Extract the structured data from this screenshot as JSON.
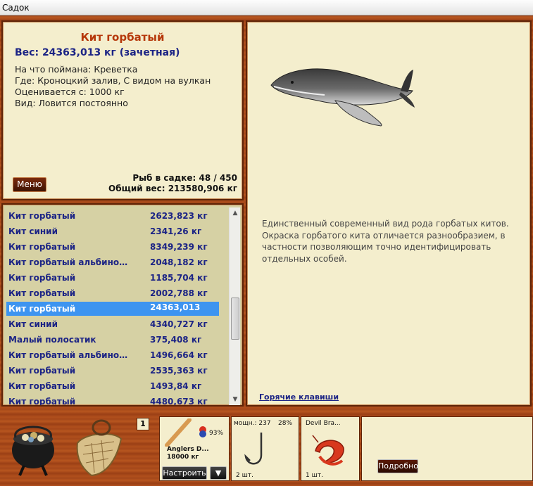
{
  "window": {
    "title": "Садок"
  },
  "fish": {
    "name": "Кит горбатый",
    "weight_line": "Вес: 24363,013 кг (зачетная)",
    "bait": "На что поймана: Креветка",
    "location": "Где: Кроноцкий залив, С видом на вулкан",
    "value": "Оценивается с: 1000 кг",
    "type": "Вид: Ловится постоянно"
  },
  "keepnet": {
    "menu_label": "Меню",
    "fish_count": "Рыб в садке: 48 / 450",
    "total_weight": "Общий вес: 213580,906 кг"
  },
  "fish_list": [
    {
      "name": "Кит горбатый",
      "weight": "2623,823 кг"
    },
    {
      "name": "Кит синий",
      "weight": "2341,26 кг"
    },
    {
      "name": "Кит горбатый",
      "weight": "8349,239 кг"
    },
    {
      "name": "Кит горбатый альбино…",
      "weight": "2048,182 кг"
    },
    {
      "name": "Кит горбатый",
      "weight": "1185,704 кг"
    },
    {
      "name": "Кит горбатый",
      "weight": "2002,788 кг"
    },
    {
      "name": "Кит горбатый",
      "weight": "24363,013",
      "selected": true
    },
    {
      "name": "Кит синий",
      "weight": "4340,727 кг"
    },
    {
      "name": "Малый полосатик",
      "weight": "375,408 кг"
    },
    {
      "name": "Кит горбатый альбино…",
      "weight": "1496,664 кг"
    },
    {
      "name": "Кит горбатый",
      "weight": "2535,363 кг"
    },
    {
      "name": "Кит горбатый",
      "weight": "1493,84 кг"
    },
    {
      "name": "Кит горбатый",
      "weight": "4480,673 кг"
    }
  ],
  "description": {
    "text": "Единственный современный вид рода горбатых китов. Окраска горбатого кита отличается разнообразием, в частности позволяющим точно идентифицировать отдельных особей.",
    "hotkeys_label": "Горячие клавиши"
  },
  "tackle": {
    "slot_number": "1",
    "rod_name": "Anglers D...",
    "rod_capacity": "18000 кг",
    "rod_percent": "93%",
    "reel_power": "мощн.: 237",
    "reel_percent": "28%",
    "hook_count": "2 шт.",
    "bait_name": "Devil Bra...",
    "bait_count": "1 шт.",
    "configure_label": "Настроить",
    "dropdown_arrow": "▼",
    "details_label": "Подробно"
  },
  "colors": {
    "accent": "#b6380a",
    "link": "#1c2485",
    "selection": "#3d94f0",
    "panel": "#f4eecd",
    "wood": "#a4471a"
  }
}
